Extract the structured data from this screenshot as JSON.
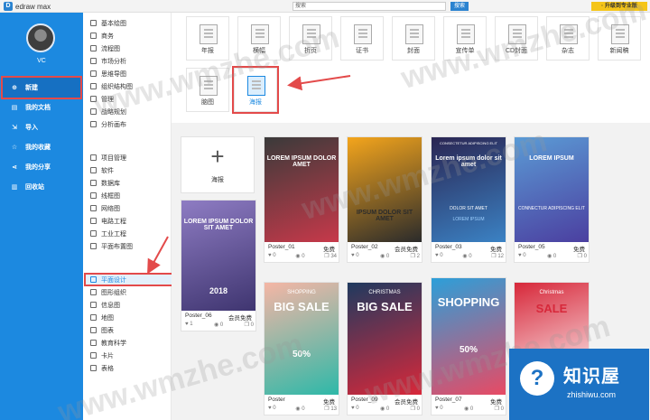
{
  "app": {
    "name": "edraw max",
    "logo_letter": "D"
  },
  "topbar": {
    "search_placeholder": "搜索",
    "search_button": "搜索",
    "upgrade_label": "· 升级到专业版"
  },
  "user": {
    "name": "VC"
  },
  "sidebar": {
    "items": [
      {
        "label": "新建",
        "icon": "new-file-icon",
        "glyph": "⊕",
        "active": true
      },
      {
        "label": "我的文档",
        "icon": "document-icon",
        "glyph": "▤"
      },
      {
        "label": "导入",
        "icon": "import-icon",
        "glyph": "⇲"
      },
      {
        "label": "我的收藏",
        "icon": "star-icon",
        "glyph": "☆"
      },
      {
        "label": "我的分享",
        "icon": "share-icon",
        "glyph": "⋖"
      },
      {
        "label": "回收站",
        "icon": "trash-icon",
        "glyph": "▥"
      }
    ]
  },
  "categories": [
    {
      "label": "基本绘图"
    },
    {
      "label": "商务"
    },
    {
      "label": "流程图"
    },
    {
      "label": "市场分析"
    },
    {
      "label": "思维导图"
    },
    {
      "label": "组织结构图"
    },
    {
      "label": "管理"
    },
    {
      "label": "战略规划"
    },
    {
      "label": "分析画布"
    },
    {
      "label": "项目管理"
    },
    {
      "label": "软件"
    },
    {
      "label": "数据库"
    },
    {
      "label": "线框图"
    },
    {
      "label": "网络图"
    },
    {
      "label": "电路工程"
    },
    {
      "label": "工业工程"
    },
    {
      "label": "平面布置图"
    },
    {
      "label": "平面设计",
      "active": true
    },
    {
      "label": "图形组织"
    },
    {
      "label": "信息图"
    },
    {
      "label": "地图"
    },
    {
      "label": "图表"
    },
    {
      "label": "教育科学"
    },
    {
      "label": "卡片"
    },
    {
      "label": "表格"
    }
  ],
  "types": [
    {
      "label": "年报"
    },
    {
      "label": "横幅"
    },
    {
      "label": "折页"
    },
    {
      "label": "证书"
    },
    {
      "label": "封面"
    },
    {
      "label": "宣传单"
    },
    {
      "label": "CD封面"
    },
    {
      "label": "杂志"
    },
    {
      "label": "新闻稿"
    },
    {
      "label": "脑图"
    },
    {
      "label": "海报",
      "active": true
    }
  ],
  "new_card": {
    "plus": "+",
    "label": "海报"
  },
  "templates": [
    {
      "name": "Poster_01",
      "price": "免费",
      "likes": "0",
      "views": "0",
      "copies": "34",
      "title": "LOREM IPSUM DOLOR AMET",
      "colors": [
        "#3a3a3a",
        "#c7394a"
      ]
    },
    {
      "name": "Poster_02",
      "price": "会员免费",
      "likes": "0",
      "views": "0",
      "copies": "2",
      "title": "IPSUM DOLOR SIT AMET",
      "colors": [
        "#f4a51c",
        "#2b2b2b"
      ]
    },
    {
      "name": "Poster_03",
      "price": "免费",
      "likes": "0",
      "views": "0",
      "copies": "12",
      "title": "Lorem ipsum dolor sit amet",
      "subtitle": "DOLOR SIT AMET",
      "ribbon": "CONSECTETUR ADIPISCING ELIT",
      "extra": "LOREM IPSUM",
      "colors": [
        "#2a2552",
        "#3b82c4"
      ]
    },
    {
      "name": "Poster_05",
      "price": "免费",
      "likes": "0",
      "views": "0",
      "copies": "0",
      "title": "LOREM IPSUM",
      "subtitle": "CONNECTUR ADIPISCING ELIT",
      "colors": [
        "#5b9bd5",
        "#4b3fa0"
      ]
    },
    {
      "name": "Poster_06",
      "price": "会员免费",
      "likes": "1",
      "views": "0",
      "copies": "0",
      "title": "LOREM IPSUM DOLOR SIT AMET",
      "year": "2018",
      "colors": [
        "#8e7cc3",
        "#3f3570"
      ]
    },
    {
      "name": "Poster",
      "price": "免费",
      "likes": "0",
      "views": "0",
      "copies": "13",
      "title": "BIG SALE",
      "top": "SHOPPING",
      "pct": "50%",
      "colors": [
        "#f5b6a5",
        "#2eb8a8"
      ]
    },
    {
      "name": "Poster_09",
      "price": "会员免费",
      "likes": "0",
      "views": "0",
      "copies": "0",
      "title": "BIG SALE",
      "top": "CHRISTMAS",
      "colors": [
        "#1f3a5f",
        "#d8283a"
      ]
    },
    {
      "name": "Poster_07",
      "price": "免费",
      "likes": "0",
      "views": "0",
      "copies": "0",
      "title": "SHOPPING",
      "pct": "50%",
      "colors": [
        "#2c9fd9",
        "#e84a64"
      ]
    },
    {
      "name": "",
      "price": "",
      "title": "SALE",
      "top": "Christmas",
      "colors": [
        "#d7283a",
        "#ffffff"
      ]
    }
  ],
  "watermark": {
    "text": "www.wmzhe.com",
    "brand_title": "知识屋",
    "brand_sub": "zhishiwu.com",
    "brand_glyph": "?"
  }
}
